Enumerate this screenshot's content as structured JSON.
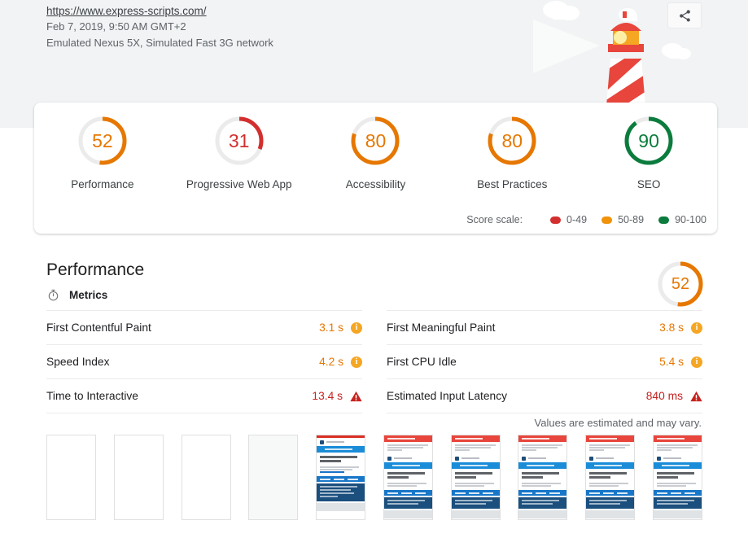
{
  "header": {
    "url": "https://www.express-scripts.com/",
    "timestamp": "Feb 7, 2019, 9:50 AM GMT+2",
    "environment": "Emulated Nexus 5X, Simulated Fast 3G network",
    "share_icon": "share-icon",
    "hero_icon": "lighthouse-illustration"
  },
  "scores": {
    "categories": [
      {
        "label": "Performance",
        "value": 52,
        "color": "#e67700"
      },
      {
        "label": "Progressive Web App",
        "value": 31,
        "color": "#d32f2f"
      },
      {
        "label": "Accessibility",
        "value": 80,
        "color": "#e67700"
      },
      {
        "label": "Best Practices",
        "value": 80,
        "color": "#e67700"
      },
      {
        "label": "SEO",
        "value": 90,
        "color": "#0b7c3d"
      }
    ],
    "scale": {
      "title": "Score scale:",
      "items": [
        {
          "label": "0-49",
          "color": "#d32f2f"
        },
        {
          "label": "50-89",
          "color": "#f0920a"
        },
        {
          "label": "90-100",
          "color": "#0b7c3d"
        }
      ]
    }
  },
  "performance": {
    "title": "Performance",
    "score": 52,
    "score_color": "#e67700",
    "metrics_header": "Metrics",
    "metrics_icon": "stopwatch-icon",
    "left_metrics": [
      {
        "name": "First Contentful Paint",
        "value": "3.1 s",
        "status": "average"
      },
      {
        "name": "Speed Index",
        "value": "4.2 s",
        "status": "average"
      },
      {
        "name": "Time to Interactive",
        "value": "13.4 s",
        "status": "fail"
      }
    ],
    "right_metrics": [
      {
        "name": "First Meaningful Paint",
        "value": "3.8 s",
        "status": "average"
      },
      {
        "name": "First CPU Idle",
        "value": "5.4 s",
        "status": "average"
      },
      {
        "name": "Estimated Input Latency",
        "value": "840 ms",
        "status": "fail"
      }
    ],
    "estimate_note": "Values are estimated and may vary.",
    "filmstrip": [
      {
        "state": "blank"
      },
      {
        "state": "blank"
      },
      {
        "state": "blank"
      },
      {
        "state": "blank-gray"
      },
      {
        "state": "rendered"
      },
      {
        "state": "rendered"
      },
      {
        "state": "rendered"
      },
      {
        "state": "rendered"
      },
      {
        "state": "rendered"
      },
      {
        "state": "rendered"
      }
    ]
  }
}
